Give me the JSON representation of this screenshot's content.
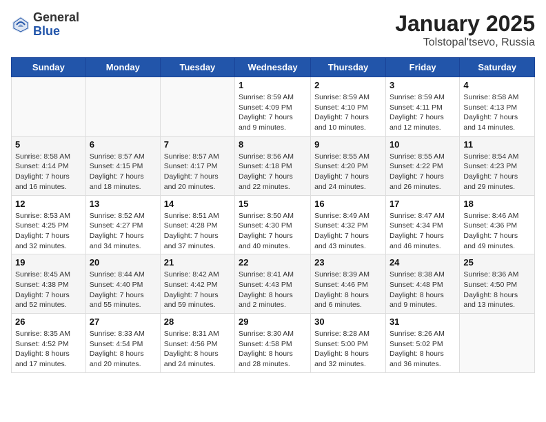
{
  "header": {
    "logo_general": "General",
    "logo_blue": "Blue",
    "title": "January 2025",
    "location": "Tolstopal'tsevo, Russia"
  },
  "days_of_week": [
    "Sunday",
    "Monday",
    "Tuesday",
    "Wednesday",
    "Thursday",
    "Friday",
    "Saturday"
  ],
  "weeks": [
    [
      {
        "day": "",
        "info": ""
      },
      {
        "day": "",
        "info": ""
      },
      {
        "day": "",
        "info": ""
      },
      {
        "day": "1",
        "info": "Sunrise: 8:59 AM\nSunset: 4:09 PM\nDaylight: 7 hours and 9 minutes."
      },
      {
        "day": "2",
        "info": "Sunrise: 8:59 AM\nSunset: 4:10 PM\nDaylight: 7 hours and 10 minutes."
      },
      {
        "day": "3",
        "info": "Sunrise: 8:59 AM\nSunset: 4:11 PM\nDaylight: 7 hours and 12 minutes."
      },
      {
        "day": "4",
        "info": "Sunrise: 8:58 AM\nSunset: 4:13 PM\nDaylight: 7 hours and 14 minutes."
      }
    ],
    [
      {
        "day": "5",
        "info": "Sunrise: 8:58 AM\nSunset: 4:14 PM\nDaylight: 7 hours and 16 minutes."
      },
      {
        "day": "6",
        "info": "Sunrise: 8:57 AM\nSunset: 4:15 PM\nDaylight: 7 hours and 18 minutes."
      },
      {
        "day": "7",
        "info": "Sunrise: 8:57 AM\nSunset: 4:17 PM\nDaylight: 7 hours and 20 minutes."
      },
      {
        "day": "8",
        "info": "Sunrise: 8:56 AM\nSunset: 4:18 PM\nDaylight: 7 hours and 22 minutes."
      },
      {
        "day": "9",
        "info": "Sunrise: 8:55 AM\nSunset: 4:20 PM\nDaylight: 7 hours and 24 minutes."
      },
      {
        "day": "10",
        "info": "Sunrise: 8:55 AM\nSunset: 4:22 PM\nDaylight: 7 hours and 26 minutes."
      },
      {
        "day": "11",
        "info": "Sunrise: 8:54 AM\nSunset: 4:23 PM\nDaylight: 7 hours and 29 minutes."
      }
    ],
    [
      {
        "day": "12",
        "info": "Sunrise: 8:53 AM\nSunset: 4:25 PM\nDaylight: 7 hours and 32 minutes."
      },
      {
        "day": "13",
        "info": "Sunrise: 8:52 AM\nSunset: 4:27 PM\nDaylight: 7 hours and 34 minutes."
      },
      {
        "day": "14",
        "info": "Sunrise: 8:51 AM\nSunset: 4:28 PM\nDaylight: 7 hours and 37 minutes."
      },
      {
        "day": "15",
        "info": "Sunrise: 8:50 AM\nSunset: 4:30 PM\nDaylight: 7 hours and 40 minutes."
      },
      {
        "day": "16",
        "info": "Sunrise: 8:49 AM\nSunset: 4:32 PM\nDaylight: 7 hours and 43 minutes."
      },
      {
        "day": "17",
        "info": "Sunrise: 8:47 AM\nSunset: 4:34 PM\nDaylight: 7 hours and 46 minutes."
      },
      {
        "day": "18",
        "info": "Sunrise: 8:46 AM\nSunset: 4:36 PM\nDaylight: 7 hours and 49 minutes."
      }
    ],
    [
      {
        "day": "19",
        "info": "Sunrise: 8:45 AM\nSunset: 4:38 PM\nDaylight: 7 hours and 52 minutes."
      },
      {
        "day": "20",
        "info": "Sunrise: 8:44 AM\nSunset: 4:40 PM\nDaylight: 7 hours and 55 minutes."
      },
      {
        "day": "21",
        "info": "Sunrise: 8:42 AM\nSunset: 4:42 PM\nDaylight: 7 hours and 59 minutes."
      },
      {
        "day": "22",
        "info": "Sunrise: 8:41 AM\nSunset: 4:43 PM\nDaylight: 8 hours and 2 minutes."
      },
      {
        "day": "23",
        "info": "Sunrise: 8:39 AM\nSunset: 4:46 PM\nDaylight: 8 hours and 6 minutes."
      },
      {
        "day": "24",
        "info": "Sunrise: 8:38 AM\nSunset: 4:48 PM\nDaylight: 8 hours and 9 minutes."
      },
      {
        "day": "25",
        "info": "Sunrise: 8:36 AM\nSunset: 4:50 PM\nDaylight: 8 hours and 13 minutes."
      }
    ],
    [
      {
        "day": "26",
        "info": "Sunrise: 8:35 AM\nSunset: 4:52 PM\nDaylight: 8 hours and 17 minutes."
      },
      {
        "day": "27",
        "info": "Sunrise: 8:33 AM\nSunset: 4:54 PM\nDaylight: 8 hours and 20 minutes."
      },
      {
        "day": "28",
        "info": "Sunrise: 8:31 AM\nSunset: 4:56 PM\nDaylight: 8 hours and 24 minutes."
      },
      {
        "day": "29",
        "info": "Sunrise: 8:30 AM\nSunset: 4:58 PM\nDaylight: 8 hours and 28 minutes."
      },
      {
        "day": "30",
        "info": "Sunrise: 8:28 AM\nSunset: 5:00 PM\nDaylight: 8 hours and 32 minutes."
      },
      {
        "day": "31",
        "info": "Sunrise: 8:26 AM\nSunset: 5:02 PM\nDaylight: 8 hours and 36 minutes."
      },
      {
        "day": "",
        "info": ""
      }
    ]
  ]
}
